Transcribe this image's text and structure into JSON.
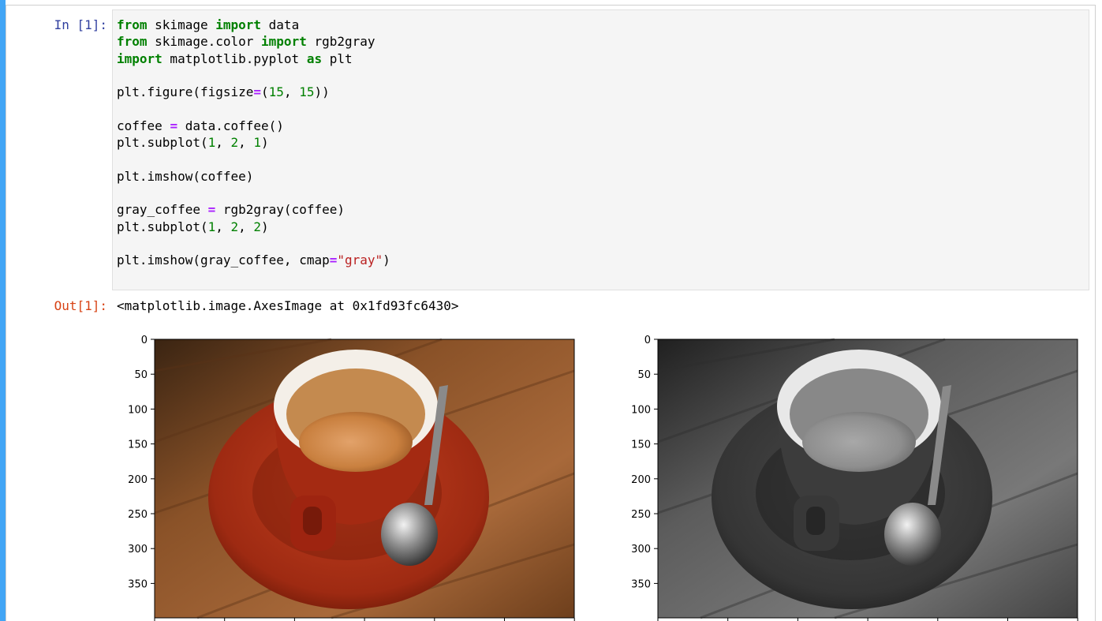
{
  "cell_input": {
    "prompt": "In [1]:",
    "code_lines": [
      [
        {
          "t": "from",
          "c": "kw"
        },
        {
          "t": " skimage "
        },
        {
          "t": "import",
          "c": "kw"
        },
        {
          "t": " data"
        }
      ],
      [
        {
          "t": "from",
          "c": "kw"
        },
        {
          "t": " skimage.color "
        },
        {
          "t": "import",
          "c": "kw"
        },
        {
          "t": " rgb2gray"
        }
      ],
      [
        {
          "t": "import",
          "c": "kw"
        },
        {
          "t": " matplotlib.pyplot "
        },
        {
          "t": "as",
          "c": "kw"
        },
        {
          "t": " plt"
        }
      ],
      [],
      [
        {
          "t": "plt.figure(figsize"
        },
        {
          "t": "=",
          "c": "op"
        },
        {
          "t": "("
        },
        {
          "t": "15",
          "c": "num"
        },
        {
          "t": ", "
        },
        {
          "t": "15",
          "c": "num"
        },
        {
          "t": "))"
        }
      ],
      [],
      [
        {
          "t": "coffee "
        },
        {
          "t": "=",
          "c": "op"
        },
        {
          "t": " data.coffee()"
        }
      ],
      [
        {
          "t": "plt.subplot("
        },
        {
          "t": "1",
          "c": "num"
        },
        {
          "t": ", "
        },
        {
          "t": "2",
          "c": "num"
        },
        {
          "t": ", "
        },
        {
          "t": "1",
          "c": "num"
        },
        {
          "t": ")"
        }
      ],
      [],
      [
        {
          "t": "plt.imshow(coffee)"
        }
      ],
      [],
      [
        {
          "t": "gray_coffee "
        },
        {
          "t": "=",
          "c": "op"
        },
        {
          "t": " rgb2gray(coffee)"
        }
      ],
      [
        {
          "t": "plt.subplot("
        },
        {
          "t": "1",
          "c": "num"
        },
        {
          "t": ", "
        },
        {
          "t": "2",
          "c": "num"
        },
        {
          "t": ", "
        },
        {
          "t": "2",
          "c": "num"
        },
        {
          "t": ")"
        }
      ],
      [],
      [
        {
          "t": "plt.imshow(gray_coffee, cmap"
        },
        {
          "t": "=",
          "c": "op"
        },
        {
          "t": "\"gray\"",
          "c": "str"
        },
        {
          "t": ")"
        }
      ]
    ]
  },
  "cell_output": {
    "prompt": "Out[1]:",
    "text": "<matplotlib.image.AxesImage at 0x1fd93fc6430>"
  },
  "figure": {
    "y_ticks": [
      "0",
      "50",
      "100",
      "150",
      "200",
      "250",
      "300",
      "350"
    ],
    "left_image": "coffee-color",
    "right_image": "coffee-gray"
  },
  "colors": {
    "selection_bar": "#42a5f5",
    "in_prompt": "#303f9f",
    "out_prompt": "#d84315"
  }
}
